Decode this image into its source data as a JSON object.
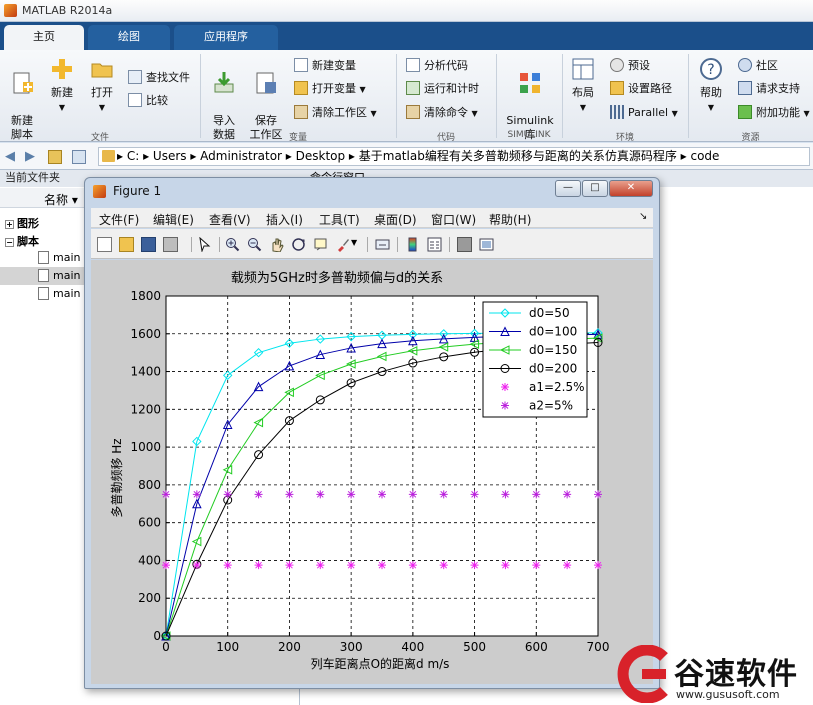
{
  "app": {
    "title": "MATLAB R2014a"
  },
  "tabs": [
    {
      "label": "主页"
    },
    {
      "label": "绘图"
    },
    {
      "label": "应用程序"
    }
  ],
  "ribbon": {
    "file_group": {
      "new_script": "新建\n脚本",
      "new": "新建",
      "open": "打开",
      "find_files": "查找文件",
      "compare": "比较",
      "label": "文件"
    },
    "variable_group": {
      "import": "导入\n数据",
      "save_workspace": "保存\n工作区",
      "new_variable": "新建变量",
      "open_variable": "打开变量",
      "clear_workspace": "清除工作区",
      "label": "变量"
    },
    "code_group": {
      "analyze": "分析代码",
      "run_time": "运行和计时",
      "clear_commands": "清除命令",
      "label": "代码"
    },
    "simulink_group": {
      "simulink": "Simulink\n库",
      "label": "SIMULINK"
    },
    "env_group": {
      "layout": "布局",
      "preferences": "预设",
      "set_path": "设置路径",
      "parallel": "Parallel",
      "label": "环境"
    },
    "resources_group": {
      "help": "帮助",
      "community": "社区",
      "support": "请求支持",
      "addons": "附加功能",
      "label": "资源"
    }
  },
  "address": {
    "path": "▸  C:  ▸  Users  ▸  Administrator  ▸  Desktop  ▸  基于matlab编程有关多普勒频移与距离的关系仿真源码程序  ▸  code"
  },
  "left_panel": {
    "header": "当前文件夹",
    "column_name": "名称 ▾",
    "tree": [
      {
        "label": "图形"
      },
      {
        "label": "脚本"
      },
      {
        "label": "main"
      },
      {
        "label": "main"
      },
      {
        "label": "main"
      }
    ]
  },
  "right_panel": {
    "header": "命令行窗口"
  },
  "figure": {
    "title": "Figure 1",
    "menu": [
      "文件(F)",
      "编辑(E)",
      "查看(V)",
      "插入(I)",
      "工具(T)",
      "桌面(D)",
      "窗口(W)",
      "帮助(H)"
    ],
    "menu_arrow": "↘",
    "win_buttons": {
      "minimize": "—",
      "maximize": "□",
      "close": "✕"
    }
  },
  "chart_data": {
    "type": "line",
    "title": "载频为5GHz时多普勒频偏与d的关系",
    "xlabel": "列车距离点O的距离d m/s",
    "ylabel": "多普勒频移 Hz",
    "xlim": [
      0,
      700
    ],
    "ylim": [
      0,
      1800
    ],
    "xticks": [
      0,
      100,
      200,
      300,
      400,
      500,
      600,
      700
    ],
    "yticks": [
      0,
      200,
      400,
      600,
      800,
      1000,
      1200,
      1400,
      1600,
      1800
    ],
    "grid": true,
    "legend_position": "top-right",
    "x": [
      0,
      50,
      100,
      150,
      200,
      250,
      300,
      350,
      400,
      450,
      500,
      550,
      600,
      650,
      700
    ],
    "series": [
      {
        "name": "d0=50",
        "color": "#00e5ee",
        "marker": "diamond",
        "values": [
          0,
          1030,
          1380,
          1500,
          1550,
          1572,
          1585,
          1592,
          1597,
          1600,
          1602,
          1603,
          1604,
          1605,
          1605
        ]
      },
      {
        "name": "d0=100",
        "color": "#0000aa",
        "marker": "triangle-up",
        "values": [
          0,
          700,
          1120,
          1320,
          1430,
          1490,
          1525,
          1548,
          1563,
          1573,
          1581,
          1587,
          1591,
          1594,
          1597
        ]
      },
      {
        "name": "d0=150",
        "color": "#22cc22",
        "marker": "triangle-left",
        "values": [
          0,
          500,
          880,
          1130,
          1290,
          1380,
          1440,
          1480,
          1510,
          1530,
          1545,
          1556,
          1565,
          1572,
          1577
        ]
      },
      {
        "name": "d0=200",
        "color": "#000000",
        "marker": "circle",
        "values": [
          0,
          380,
          720,
          960,
          1140,
          1250,
          1340,
          1400,
          1445,
          1478,
          1502,
          1520,
          1534,
          1545,
          1554
        ]
      },
      {
        "name": "a1=2.5%",
        "color": "#ee22ee",
        "marker": "star",
        "line": false,
        "values": [
          375,
          375,
          375,
          375,
          375,
          375,
          375,
          375,
          375,
          375,
          375,
          375,
          375,
          375,
          375
        ]
      },
      {
        "name": "a2=5%",
        "color": "#bb22dd",
        "marker": "star",
        "line": false,
        "values": [
          750,
          750,
          750,
          750,
          750,
          750,
          750,
          750,
          750,
          750,
          750,
          750,
          750,
          750,
          750
        ]
      }
    ]
  },
  "watermark": {
    "brand": "谷速软件",
    "site": "www.gususoft.com"
  },
  "colors": {
    "tab_bar": "#1b4f8a",
    "ribbon_bg": "#eef2f6",
    "figure_frame": "#c7d6e8"
  }
}
